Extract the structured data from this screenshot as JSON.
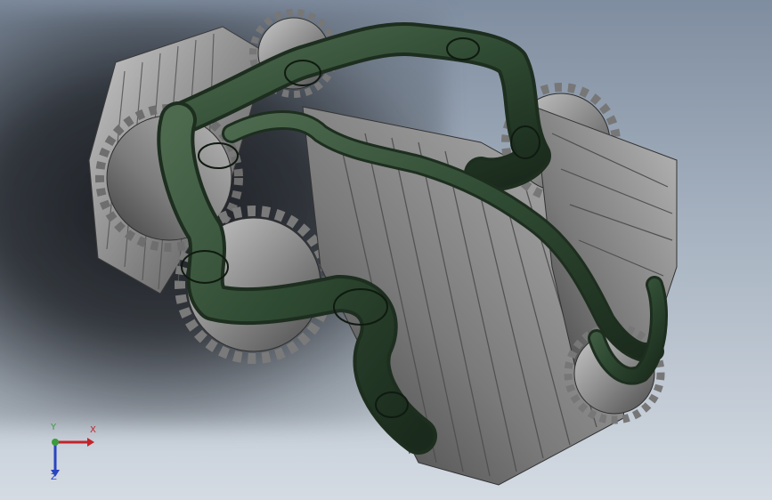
{
  "viewport": {
    "background_top": "#7f8da0",
    "background_bottom": "#d4dbe3",
    "model_colors": {
      "gear_metal": "#8a8a8a",
      "gear_shadow": "#4a4a4a",
      "chain_green": "#2f4a32"
    }
  },
  "triad": {
    "x_label": "X",
    "y_label": "Y",
    "z_label": "Z",
    "colors": {
      "x": "#c2242a",
      "y": "#3c9b3c",
      "z": "#2a45c0"
    }
  }
}
